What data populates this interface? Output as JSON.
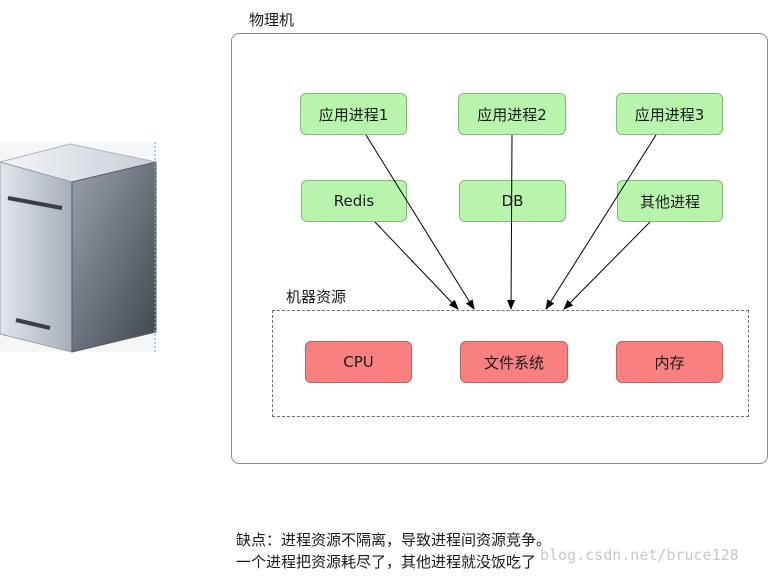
{
  "diagram": {
    "physical_machine_label": "物理机",
    "resources_label": "机器资源",
    "processes": [
      {
        "id": "app1",
        "label": "应用进程1"
      },
      {
        "id": "app2",
        "label": "应用进程2"
      },
      {
        "id": "app3",
        "label": "应用进程3"
      },
      {
        "id": "redis",
        "label": "Redis"
      },
      {
        "id": "db",
        "label": "DB"
      },
      {
        "id": "other",
        "label": "其他进程"
      }
    ],
    "resources": [
      {
        "id": "cpu",
        "label": "CPU"
      },
      {
        "id": "fs",
        "label": "文件系统"
      },
      {
        "id": "mem",
        "label": "内存"
      }
    ],
    "edges": [
      {
        "from": "app1",
        "to": "machine-resources"
      },
      {
        "from": "app2",
        "to": "machine-resources"
      },
      {
        "from": "app3",
        "to": "machine-resources"
      },
      {
        "from": "redis",
        "to": "machine-resources"
      },
      {
        "from": "other",
        "to": "machine-resources"
      }
    ],
    "colors": {
      "process_fill": "#b9f4ad",
      "resource_fill": "#f88080",
      "arrow": "#000000"
    }
  },
  "notes": {
    "line1": "缺点：进程资源不隔离，导致进程间资源竞争。",
    "line2": "一个进程把资源耗尽了，其他进程就没饭吃了"
  },
  "watermark": "blog.csdn.net/bruce128",
  "server_icon": "server-tower-icon"
}
